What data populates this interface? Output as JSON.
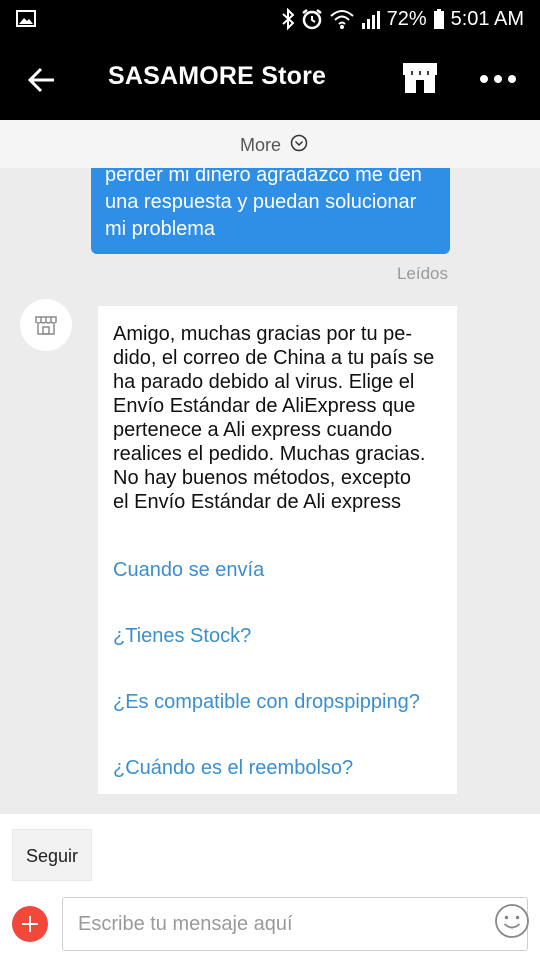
{
  "status_bar": {
    "battery": "72%",
    "time": "5:01 AM"
  },
  "app_bar": {
    "title": "SASAMORE Store"
  },
  "more_bar": {
    "label": "More"
  },
  "chat": {
    "outgoing": {
      "lines": [
        "perder mi dinero agradazco me den",
        "una respuesta y puedan solucionar",
        "mi problema"
      ],
      "status": "Leídos"
    },
    "incoming": {
      "lines": [
        "Amigo, muchas gracias por tu pe-",
        "dido, el correo de China a tu país se",
        "ha parado debido al virus. Elige el",
        "Envío Estándar de AliExpress que",
        "pertenece a Ali express cuando",
        "realices el pedido. Muchas gracias.",
        "No hay buenos métodos, excepto",
        "el Envío Estándar de Ali express"
      ],
      "quick_questions": [
        "Cuando se envía",
        "¿Tienes Stock?",
        "¿Es compatible con dropspipping?",
        "¿Cuándo es el reembolso?"
      ]
    }
  },
  "follow_button": "Seguir",
  "composer": {
    "placeholder": "Escribe tu mensaje aquí"
  }
}
